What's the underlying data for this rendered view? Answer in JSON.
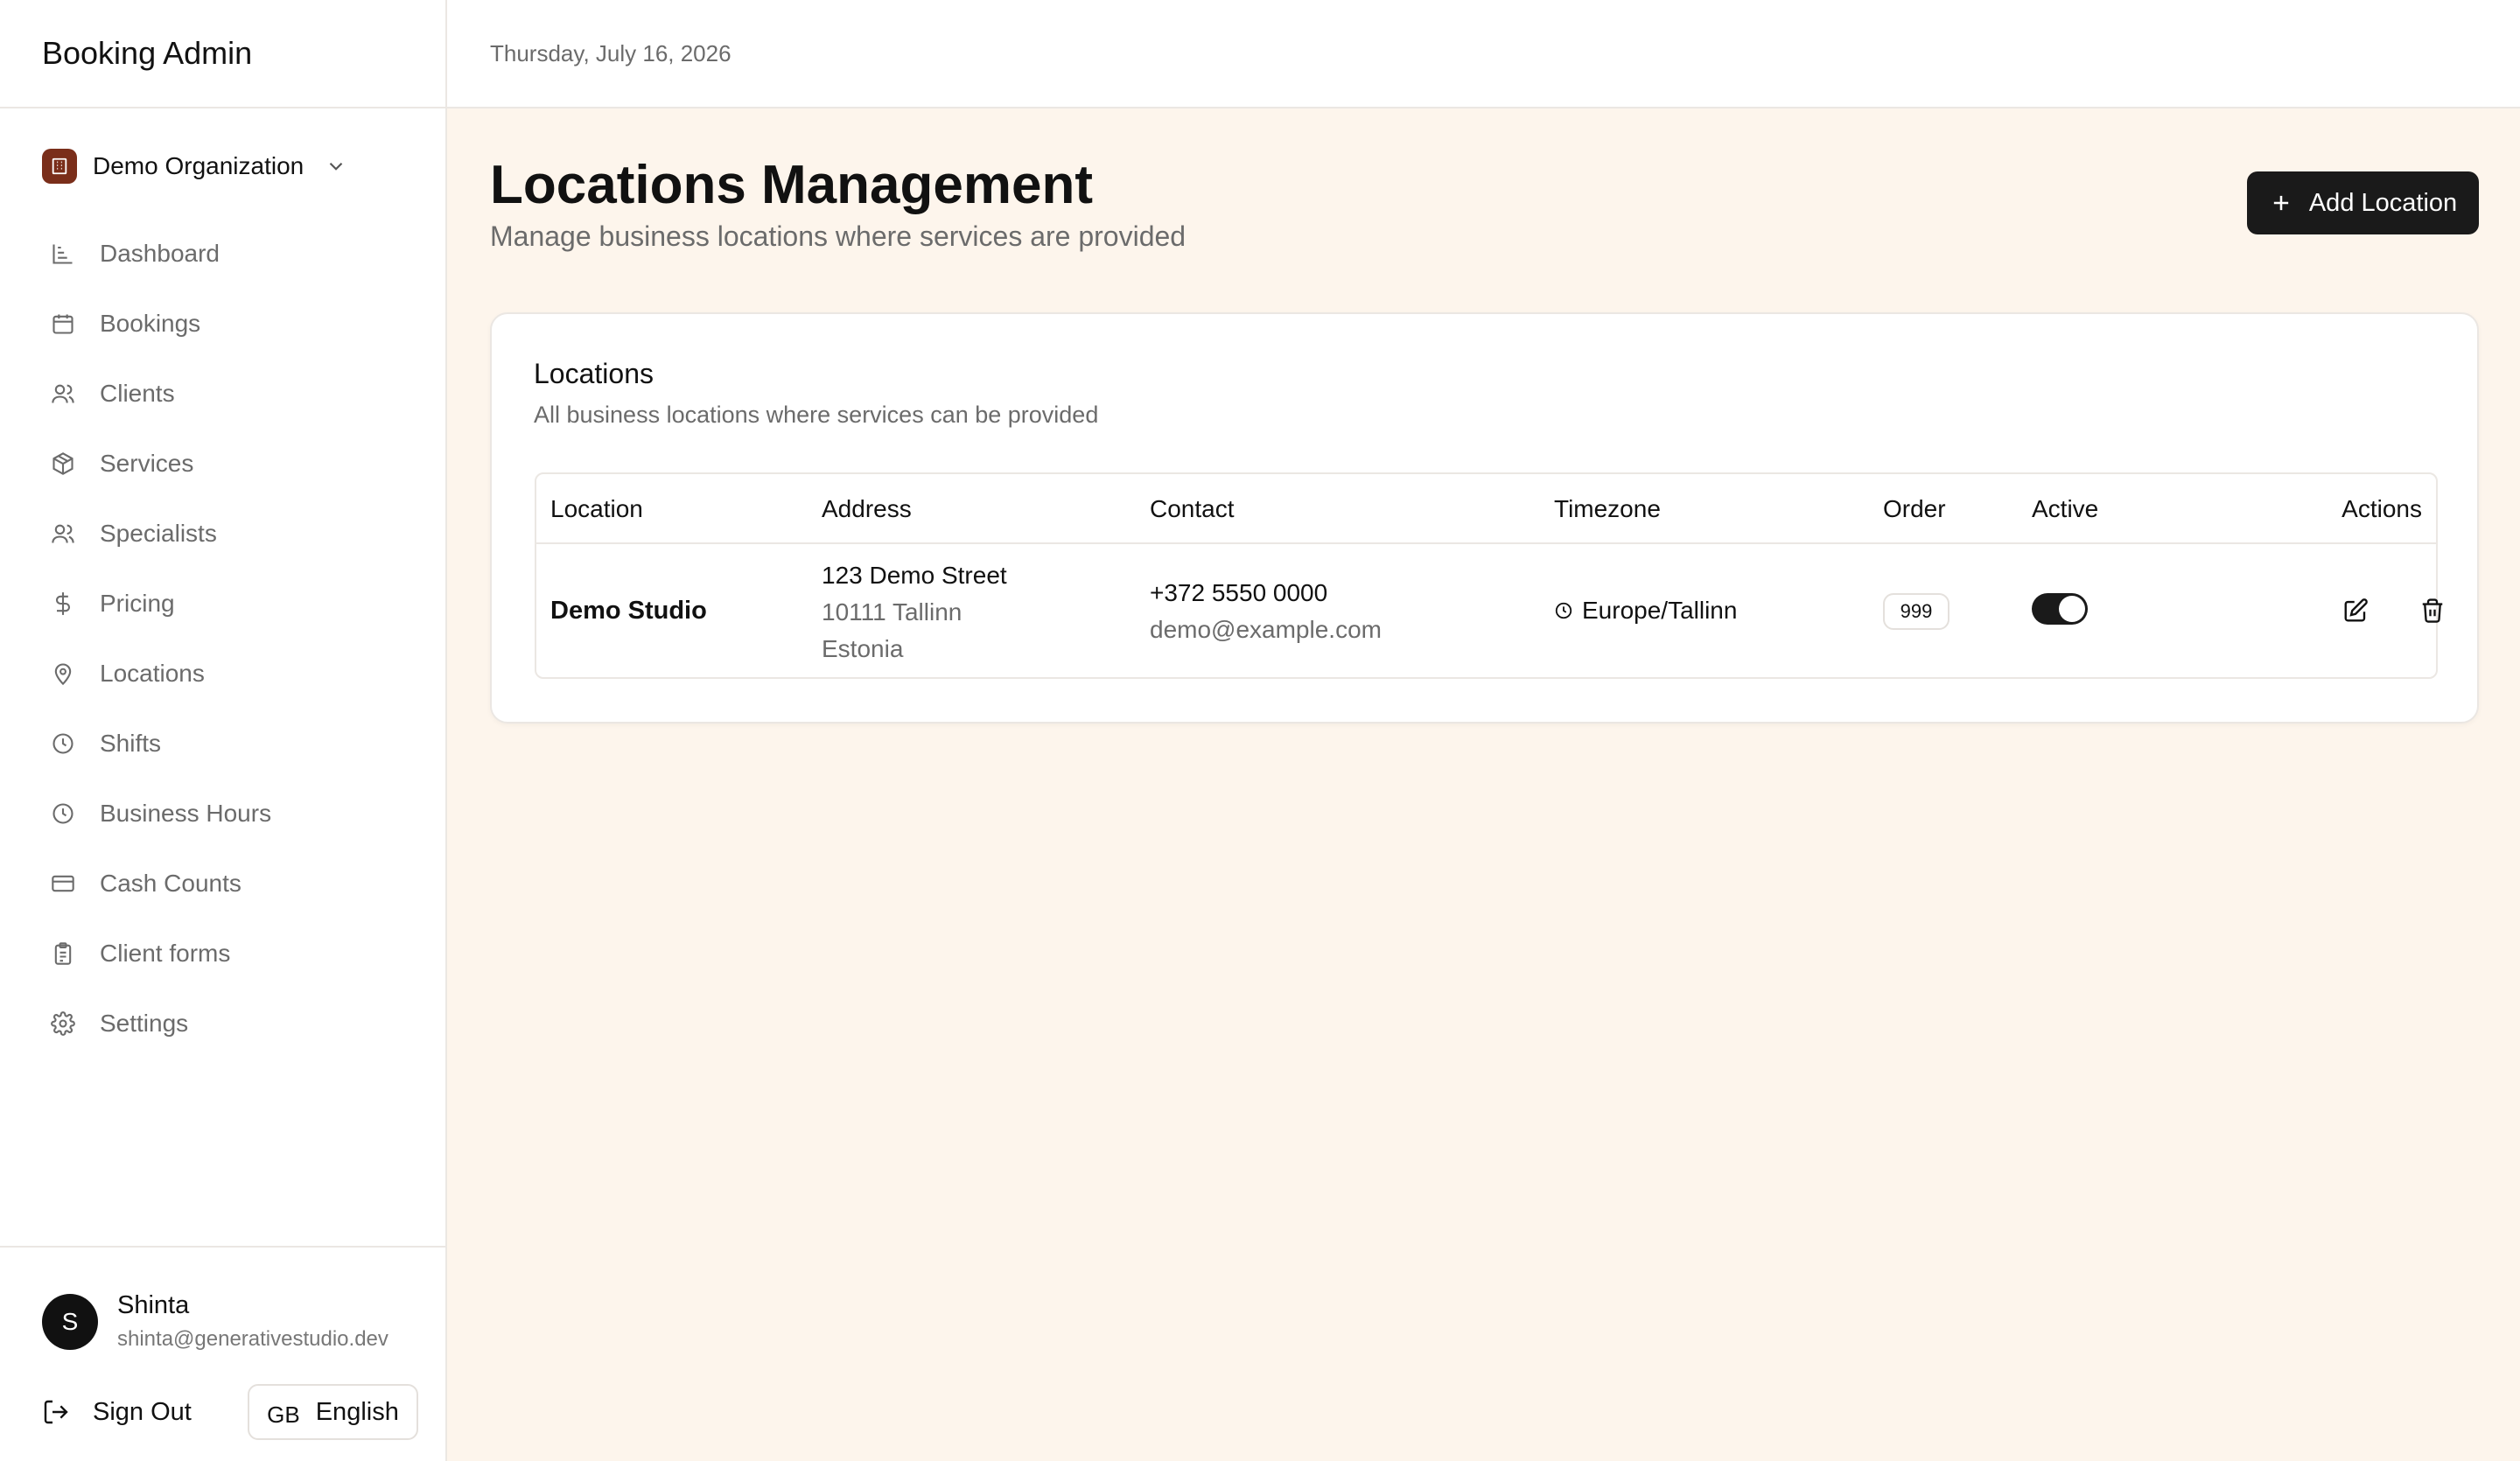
{
  "app": {
    "title": "Booking Admin"
  },
  "topbar": {
    "date": "Thursday, July 16, 2026"
  },
  "organization": {
    "name": "Demo Organization",
    "icon": "building-icon"
  },
  "sidebar": {
    "items": [
      {
        "label": "Dashboard",
        "icon": "chart-icon"
      },
      {
        "label": "Bookings",
        "icon": "calendar-icon"
      },
      {
        "label": "Clients",
        "icon": "users-icon"
      },
      {
        "label": "Services",
        "icon": "package-icon"
      },
      {
        "label": "Specialists",
        "icon": "users-icon"
      },
      {
        "label": "Pricing",
        "icon": "dollar-icon"
      },
      {
        "label": "Locations",
        "icon": "map-pin-icon"
      },
      {
        "label": "Shifts",
        "icon": "clock-icon"
      },
      {
        "label": "Business Hours",
        "icon": "clock-icon"
      },
      {
        "label": "Cash Counts",
        "icon": "credit-card-icon"
      },
      {
        "label": "Client forms",
        "icon": "clipboard-icon"
      },
      {
        "label": "Settings",
        "icon": "gear-icon"
      }
    ]
  },
  "user": {
    "initial": "S",
    "name": "Shinta",
    "email": "shinta@generativestudio.dev"
  },
  "footer": {
    "sign_out": "Sign Out",
    "lang_code": "GB",
    "lang_label": "English"
  },
  "page": {
    "title": "Locations Management",
    "subtitle": "Manage business locations where services are provided",
    "add_button": "Add Location"
  },
  "card": {
    "title": "Locations",
    "description": "All business locations where services can be provided"
  },
  "table": {
    "headers": {
      "location": "Location",
      "address": "Address",
      "contact": "Contact",
      "timezone": "Timezone",
      "order": "Order",
      "active": "Active",
      "actions": "Actions"
    },
    "rows": [
      {
        "location": "Demo Studio",
        "address_line1": "123 Demo Street",
        "address_line2": "10111 Tallinn",
        "address_line3": "Estonia",
        "phone": "+372 5550 0000",
        "email": "demo@example.com",
        "timezone": "Europe/Tallinn",
        "order": "999",
        "active": true
      }
    ]
  },
  "colors": {
    "accent": "#1a1a1a",
    "background": "#fdf5ec",
    "org_logo": "#7a2e1a"
  }
}
